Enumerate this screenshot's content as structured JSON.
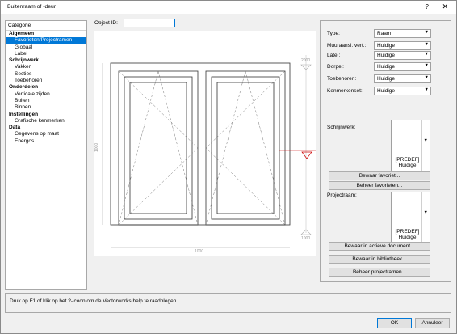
{
  "window": {
    "title": "Buitenraam of -deur",
    "help_label": "?",
    "close_label": "✕"
  },
  "sidebar": {
    "header": "Categorie",
    "items": [
      {
        "label": "Algemeen",
        "kind": "group"
      },
      {
        "label": "Favorieten/Projectramen",
        "kind": "item",
        "selected": true
      },
      {
        "label": "Globaal",
        "kind": "item"
      },
      {
        "label": "Label",
        "kind": "item"
      },
      {
        "label": "Schrijnwerk",
        "kind": "group"
      },
      {
        "label": "Vakken",
        "kind": "item"
      },
      {
        "label": "Secties",
        "kind": "item"
      },
      {
        "label": "Toebehoren",
        "kind": "item"
      },
      {
        "label": "Onderdelen",
        "kind": "group"
      },
      {
        "label": "Verticale zijden",
        "kind": "item"
      },
      {
        "label": "Buiten",
        "kind": "item"
      },
      {
        "label": "Binnen",
        "kind": "item"
      },
      {
        "label": "Instellingen",
        "kind": "group"
      },
      {
        "label": "Grafische kenmerken",
        "kind": "item"
      },
      {
        "label": "Data",
        "kind": "group"
      },
      {
        "label": "Gegevens op maat",
        "kind": "item"
      },
      {
        "label": "Energos",
        "kind": "item"
      }
    ]
  },
  "object_id": {
    "label": "Object ID:",
    "value": ""
  },
  "preview": {
    "dim_top_right": "2000",
    "dim_bottom_right": "1000",
    "dim_left": "1000",
    "dim_bottom": "1000"
  },
  "properties": {
    "fields": [
      {
        "label": "Type:",
        "value": "Raam"
      },
      {
        "label": "Muuraansl. vert.:",
        "value": "Huidige"
      },
      {
        "label": "Lateí:",
        "value": "Huidige"
      },
      {
        "label": "Dorpel:",
        "value": "Huidige"
      },
      {
        "label": "Toebehoren:",
        "value": "Huidige"
      },
      {
        "label": "Kenmerkenset:",
        "value": "Huidige"
      }
    ],
    "schrijnwerk": {
      "label": "Schrijnwerk:",
      "thumb_line1": "[PREDEF]",
      "thumb_line2": "Huidige"
    },
    "btn_save_favorite": "Bewaar favoriet...",
    "btn_manage_favorites": "Beheer favorieten...",
    "projectraam": {
      "label": "Projectraam:",
      "thumb_line1": "[PREDEF]",
      "thumb_line2": "Huidige"
    },
    "btn_save_active_doc": "Bewaar in actieve document...",
    "btn_save_library": "Bewaar in bibliotheek...",
    "btn_manage_projectramen": "Beheer projectramen..."
  },
  "status": {
    "text": "Druk op F1 of klik op het ?-icoon om de Vectorworks help te raadplegen."
  },
  "buttons": {
    "ok": "OK",
    "cancel": "Annuleer"
  },
  "icons": {
    "dropdown": "chevron-down-icon",
    "close": "close-icon",
    "help": "help-icon"
  }
}
